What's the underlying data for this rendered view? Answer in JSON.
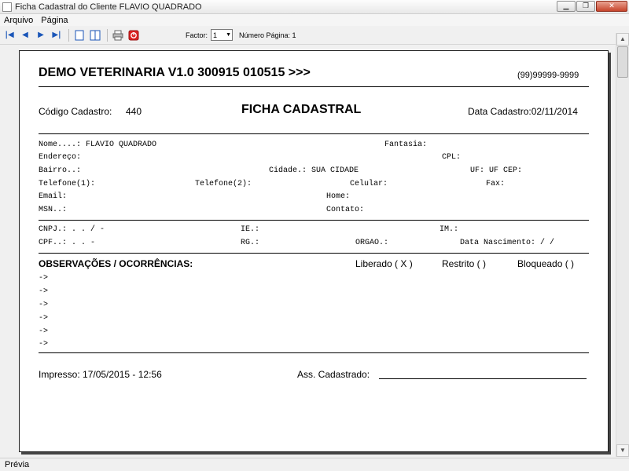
{
  "window": {
    "title": "Ficha Cadastral do Cliente FLAVIO QUADRADO"
  },
  "menu": {
    "items": [
      "Arquivo",
      "Página"
    ]
  },
  "toolbar": {
    "factor_label": "Factor:",
    "factor_value": "1",
    "page_label": "Número Página: 1"
  },
  "report": {
    "company": "DEMO VETERINARIA V1.0 300915 010515 >>>",
    "phone": "(99)99999-9999",
    "codigo_label": "Código Cadastro:",
    "codigo_value": "440",
    "title": "FICHA CADASTRAL",
    "data_cadastro": "Data Cadastro:02/11/2014",
    "fields": {
      "nome": "Nome....: FLAVIO QUADRADO",
      "fantasia": "Fantasia:",
      "endereco": "Endereço:",
      "cpl": "CPL:",
      "bairro": "Bairro..:",
      "cidade": "Cidade.: SUA CIDADE",
      "uf": "UF: UF CEP:",
      "telefone1": "Telefone(1):",
      "telefone2": "Telefone(2):",
      "celular": "Celular:",
      "fax": "Fax:",
      "email": "Email:",
      "home": "Home:",
      "msn": "MSN..:",
      "contato": "Contato:",
      "cnpj": "CNPJ.:   .   .   /    -",
      "ie": "IE.:",
      "im": "IM.:",
      "cpf": "CPF..:   .   .   -",
      "rg": "RG.:",
      "orgao": "ORGAO.:",
      "data_nascimento": "Data Nascimento:   /  /"
    },
    "obs_title": "OBSERVAÇÕES / OCORRÊNCIAS:",
    "liberado": "Liberado ( X )",
    "restrito": "Restrito (   )",
    "bloqueado": "Bloqueado (   )",
    "obs_lines": [
      "->",
      "->",
      "->",
      "->",
      "->",
      "->"
    ],
    "impresso": "Impresso: 17/05/2015 - 12:56",
    "assinatura": "Ass. Cadastrado:"
  },
  "status": {
    "text": "Prévia"
  }
}
